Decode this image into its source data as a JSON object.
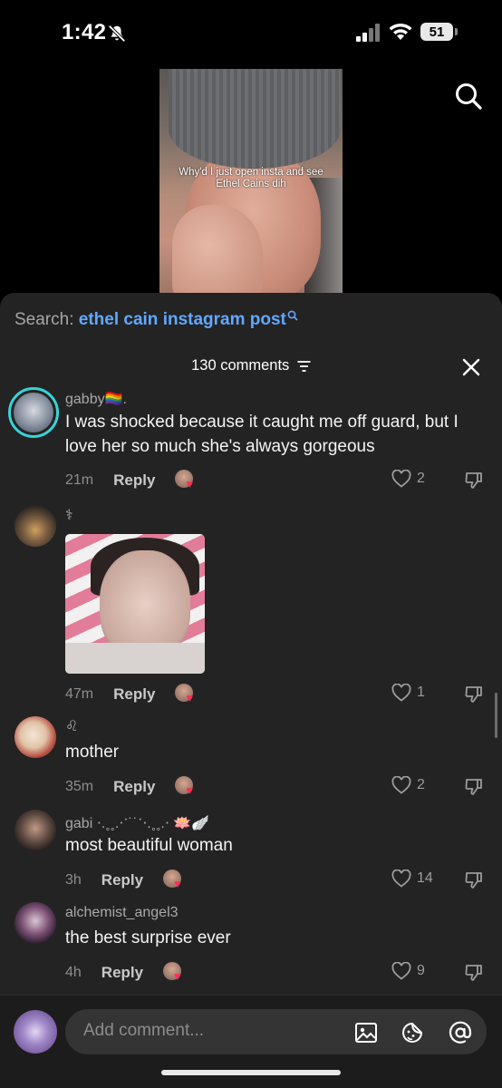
{
  "status_bar": {
    "time": "1:42",
    "battery": "51"
  },
  "video": {
    "overlay_text": "Why'd I just open insta and see Ethel Cains dih"
  },
  "search": {
    "prefix": "Search: ",
    "query": "ethel cain instagram post"
  },
  "comments_header": {
    "count_label": "130 comments"
  },
  "comments": [
    {
      "username": "gabby🏳️‍🌈.",
      "text": "I was shocked because it caught me off guard, but I love her so much she's always gorgeous",
      "time": "21m",
      "reply": "Reply",
      "likes": "2"
    },
    {
      "username": "⚕",
      "text": "",
      "time": "47m",
      "reply": "Reply",
      "likes": "1"
    },
    {
      "username": "♌",
      "text": "mother",
      "time": "35m",
      "reply": "Reply",
      "likes": "2"
    },
    {
      "username": "gabi ⋅.˳˳.⋅ॱ˙˙ॱ⋅.˳˳.⋅ 🪷🪽",
      "text": "most beautiful woman",
      "time": "3h",
      "reply": "Reply",
      "likes": "14"
    },
    {
      "username": "alchemist_angel3",
      "text": "the best surprise ever",
      "time": "4h",
      "reply": "Reply",
      "likes": "9"
    }
  ],
  "input": {
    "placeholder": "Add comment..."
  },
  "colors": {
    "accent_blue": "#61a8ff",
    "ring": "#39d2d8",
    "heart": "#ff2d55",
    "sheet_bg": "#232323"
  },
  "icons": [
    "bell-slash-icon",
    "signal-icon",
    "wifi-icon",
    "battery-icon",
    "search-icon",
    "filter-icon",
    "close-icon",
    "heart-icon",
    "dislike-icon",
    "image-icon",
    "emoji-icon",
    "at-icon"
  ]
}
